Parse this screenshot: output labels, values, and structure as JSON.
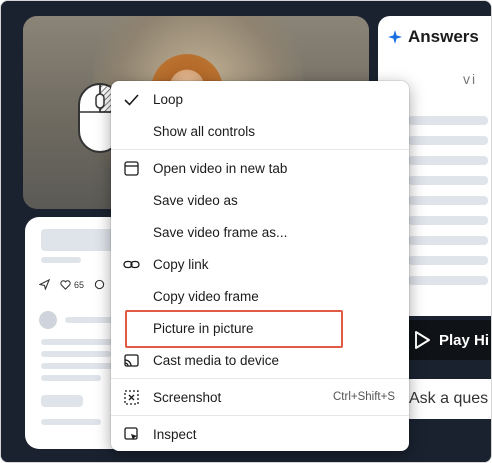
{
  "context_menu": {
    "items": [
      {
        "label": "Loop",
        "icon": "check-icon",
        "checked": true
      },
      {
        "label": "Show all controls",
        "icon": ""
      },
      {
        "label": "Open video in new tab",
        "icon": "new-tab-icon"
      },
      {
        "label": "Save video as",
        "icon": ""
      },
      {
        "label": "Save video frame as...",
        "icon": ""
      },
      {
        "label": "Copy link",
        "icon": "link-icon"
      },
      {
        "label": "Copy video frame",
        "icon": ""
      },
      {
        "label": "Picture in picture",
        "icon": "",
        "highlighted": true
      },
      {
        "label": "Cast media to device",
        "icon": "cast-icon"
      },
      {
        "label": "Screenshot",
        "icon": "screenshot-icon",
        "shortcut": "Ctrl+Shift+S"
      },
      {
        "label": "Inspect",
        "icon": "inspect-icon"
      }
    ]
  },
  "answers_panel": {
    "title": "Answers",
    "partial_text": "vi",
    "play_button_label": "Play Hi",
    "ask_placeholder": "Ask a ques"
  },
  "social_card": {
    "like_count": "65"
  },
  "colors": {
    "highlight_border": "#e05a45",
    "background": "#1a2230",
    "sparkle": "#1a6fe0"
  }
}
